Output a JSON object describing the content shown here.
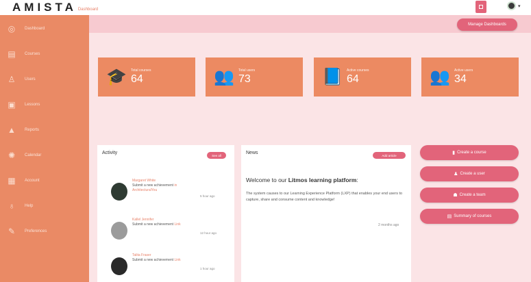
{
  "topbar": {
    "logo": "AMISTA",
    "logo_sub": "Dashboard"
  },
  "sidebar": {
    "items": [
      {
        "label": "Dashboard",
        "icon": "dashboard-icon",
        "glyph": "◎"
      },
      {
        "label": "Courses",
        "icon": "book-icon",
        "glyph": "▤"
      },
      {
        "label": "Users",
        "icon": "user-icon",
        "glyph": "♙"
      },
      {
        "label": "Lessons",
        "icon": "lock-icon",
        "glyph": "▣"
      },
      {
        "label": "Reports",
        "icon": "report-icon",
        "glyph": "▲"
      },
      {
        "label": "Calendar",
        "icon": "gear-icon",
        "glyph": "✺"
      },
      {
        "label": "Account",
        "icon": "clipboard-icon",
        "glyph": "▦"
      },
      {
        "label": "Help",
        "icon": "bulb-icon",
        "glyph": "♁"
      },
      {
        "label": "Preferences",
        "icon": "pen-icon",
        "glyph": "✎"
      }
    ]
  },
  "header": {
    "manage_label": "Manage Dashboards"
  },
  "stats": [
    {
      "label": "Total courses",
      "value": "64",
      "icon": "graduation-cap-icon",
      "glyph": "🎓"
    },
    {
      "label": "Total users",
      "value": "73",
      "icon": "users-icon",
      "glyph": "👥"
    },
    {
      "label": "Active courses",
      "value": "64",
      "icon": "book-icon",
      "glyph": "📘"
    },
    {
      "label": "Active users",
      "value": "34",
      "icon": "users-icon",
      "glyph": "👥"
    }
  ],
  "activity": {
    "title": "Activity",
    "button": "See all",
    "items": [
      {
        "name": "Margaret White",
        "line1": "Submit a new achievement",
        "line1_link": "in",
        "line2": "ArchitecturalYou",
        "time": "5 hour ago",
        "avatar_color": "#2f3b33"
      },
      {
        "name": "Kallel Jennifer",
        "line1": "Submit a new achievement",
        "line1_link": "Link",
        "line2": "",
        "time": "12 hour ago",
        "avatar_color": "#9b9b9b"
      },
      {
        "name": "Talita Fraser",
        "line1": "Submit a new achievement",
        "line1_link": "Link",
        "line2": "",
        "time": "1 hour ago",
        "avatar_color": "#2a2a2a"
      }
    ]
  },
  "news": {
    "title": "News",
    "button": "Add article",
    "welcome_pre": "Welcome to our ",
    "welcome_bold": "Litmos learning platform",
    "welcome_post": ":",
    "body": "The system causes to our Learning Experience Platform (LXP) that enables your end users to capture, share and consume content and knowledge!",
    "time": "2 months ago"
  },
  "actions": [
    {
      "label": "Create a course",
      "icon": "book-icon",
      "glyph": "▮"
    },
    {
      "label": "Create a user",
      "icon": "user-icon",
      "glyph": "♟"
    },
    {
      "label": "Create a team",
      "icon": "team-icon",
      "glyph": "☗"
    },
    {
      "label": "Summary of courses",
      "icon": "list-icon",
      "glyph": "▤"
    }
  ],
  "colors": {
    "sidebar": "#ea8a65",
    "accent": "#e2647a",
    "stat_card": "#ec8a62",
    "background": "#fbe4e6"
  }
}
